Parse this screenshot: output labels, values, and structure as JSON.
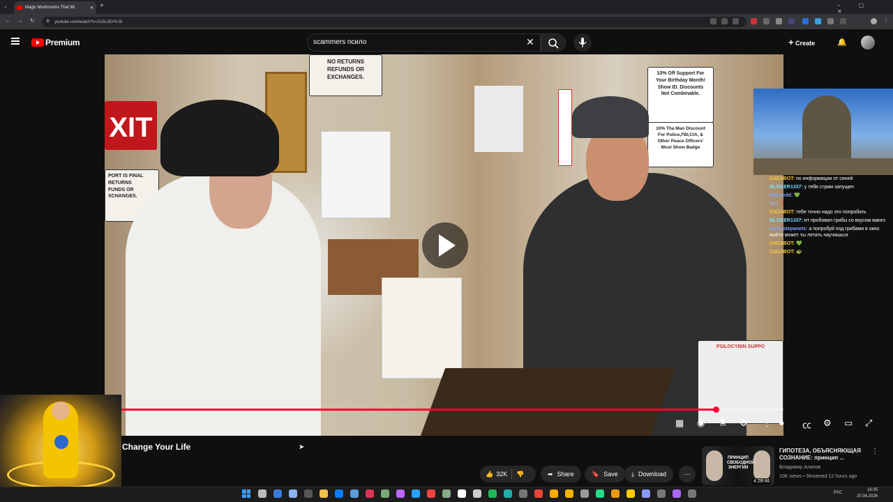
{
  "browser": {
    "tab_title": "Magic Mushrooms That Wi",
    "url": "youtube.com/watch?v=ZoScJ6YN-9I"
  },
  "header": {
    "logo_text": "Premium",
    "search_query": "scammers псило",
    "create_label": "Create"
  },
  "video": {
    "progress_fraction": 0.9,
    "signs": {
      "exit": "XIT",
      "no_returns": "NO RETURNS\nREFUNDS OR\nEXCHANGES.",
      "offer": "10% Off Support For\nYour Birthday Month!\nShow ID. Discounts\nNot Combinable.",
      "police": "10% Tha Man Discount\nFor Police,FBI,CIA, &\nOther Peace Officers'\nMust Show Badge",
      "psilocybin": "PSILOCYBIN SUPPO"
    },
    "title": "Change Your Life"
  },
  "actions": {
    "likes": "32K",
    "share": "Share",
    "save": "Save",
    "download": "Download"
  },
  "chat": [
    {
      "user": "САСАBOT:",
      "text": "по информации от синей",
      "color": "#ffcc33"
    },
    {
      "user": "BLOGER1337:",
      "text": "у тебя стрим запущен",
      "color": "#7fdcff"
    },
    {
      "user": "bblesedd:",
      "text": "💚",
      "color": "#7fa0ff"
    },
    {
      "user": "lart:",
      "text": "❗",
      "color": "#9ad"
    },
    {
      "user": "САСАBOT:",
      "text": "тебе точно надо это попробать",
      "color": "#ffcc33"
    },
    {
      "user": "BLOGER1337:",
      "text": "ит пробовал грибы со вкусом манго",
      "color": "#7fdcff"
    },
    {
      "user": "baronstepanets:",
      "text": "а попробуй под грибами в окно выйти может ты летать научишься",
      "color": "#7fa0ff"
    },
    {
      "user": "САСАBOT:",
      "text": "💚",
      "color": "#ffcc33"
    },
    {
      "user": "САСАBOT:",
      "text": "🐢",
      "color": "#ffcc33"
    }
  ],
  "recommendation": {
    "thumb_text": "ПРИНЦИП СВОБОДНОЙ ЭНЕРГИИ",
    "duration": "4:28:46",
    "title": "ГИПОТЕЗА, ОБЪЯСНЯЮЩАЯ СОЗНАНИЕ: принцип ...",
    "channel": "Владимир Алипов",
    "meta": "10K views • Streamed 12 hours ago"
  },
  "taskbar": {
    "lang": "РУС",
    "time": "16:35",
    "date": "20.04.2026"
  },
  "colors": {
    "youtube_red": "#ff0000",
    "progress": "#ff0033"
  }
}
